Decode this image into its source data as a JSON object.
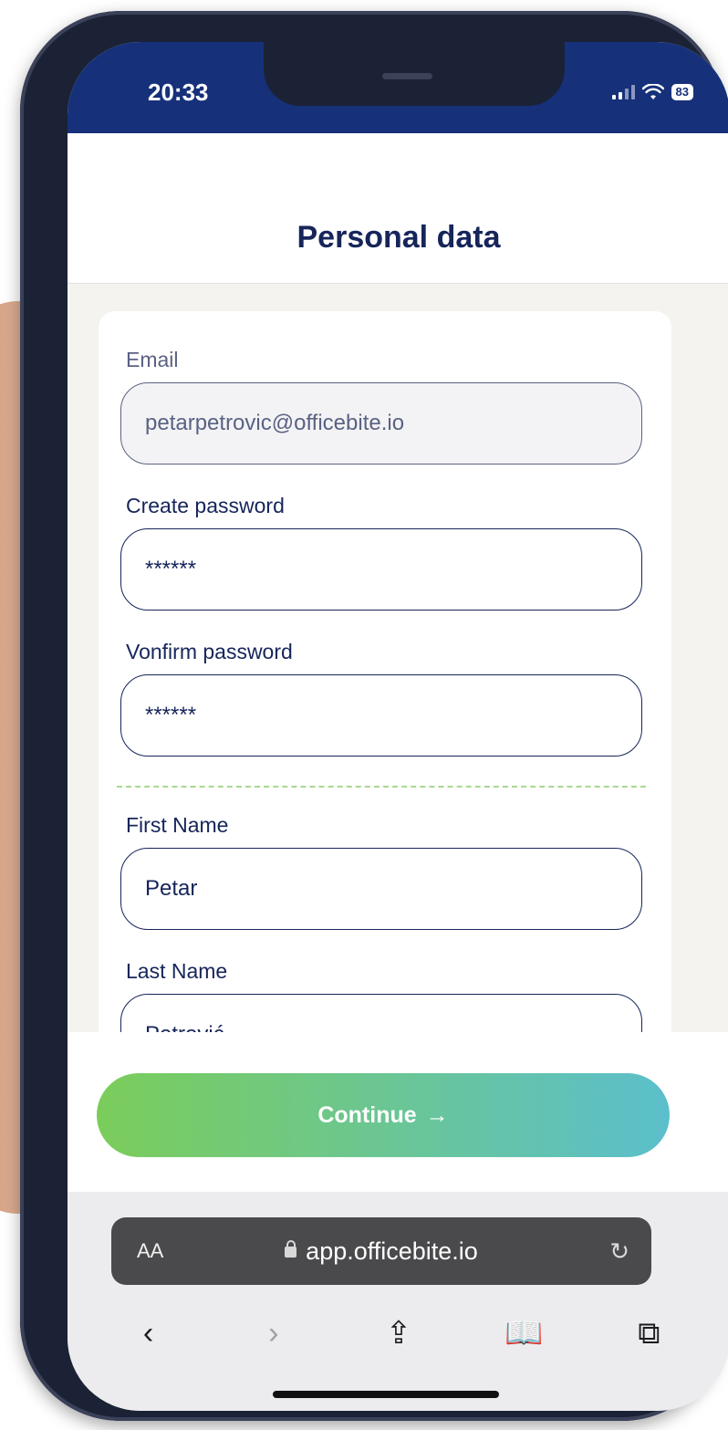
{
  "status_bar": {
    "time": "20:33",
    "battery": "83"
  },
  "header": {
    "title": "Personal data"
  },
  "form": {
    "email": {
      "label": "Email",
      "value": "petarpetrovic@officebite.io"
    },
    "create_password": {
      "label": "Create password",
      "value": "******"
    },
    "confirm_password": {
      "label": "Vonfirm password",
      "value": "******"
    },
    "first_name": {
      "label": "First Name",
      "value": "Petar"
    },
    "last_name": {
      "label": "Last Name",
      "value": "Petrović"
    }
  },
  "actions": {
    "continue_label": "Continue",
    "continue_arrow": "→"
  },
  "browser": {
    "text_size_label": "AA",
    "url": "app.officebite.io",
    "reload_icon": "↻",
    "toolbar": {
      "back": "‹",
      "forward": "›",
      "share": "⇪",
      "bookmarks": "📖",
      "tabs": "⧉"
    }
  },
  "colors": {
    "brand_navy": "#16255a",
    "status_bar": "#16317a",
    "gradient_start": "#7bcd5a",
    "gradient_end": "#5bbfcc"
  }
}
